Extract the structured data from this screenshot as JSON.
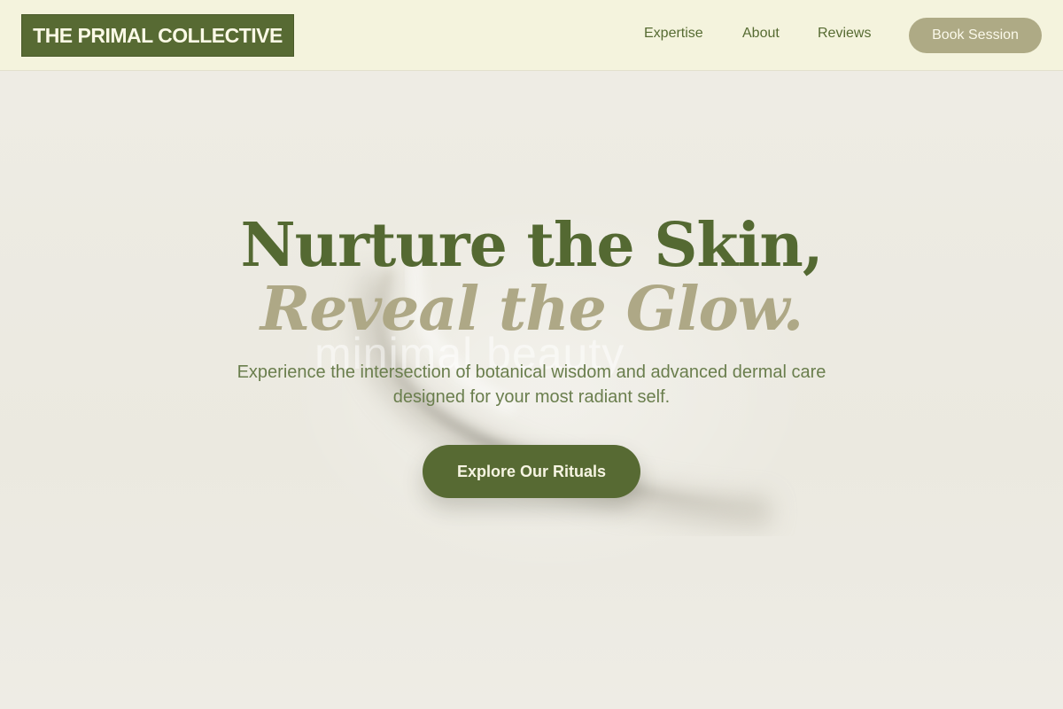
{
  "header": {
    "logo_text": "THE PRIMAL COLLECTIVE",
    "nav": [
      {
        "label": "Expertise"
      },
      {
        "label": "About"
      },
      {
        "label": "Reviews"
      }
    ],
    "book_label": "Book Session"
  },
  "hero": {
    "headline_line1": "Nurture the Skin,",
    "headline_line2": "Reveal the Glow.",
    "subtext": "Experience the intersection of botanical wisdom and advanced dermal care designed for your most radiant self.",
    "cta_label": "Explore Our Rituals",
    "background_word": "minimal beauty"
  },
  "colors": {
    "brand_green": "#576a33",
    "accent_tan": "#aeaa85",
    "header_bg": "#f4f3dd",
    "page_bg": "#efede4"
  }
}
